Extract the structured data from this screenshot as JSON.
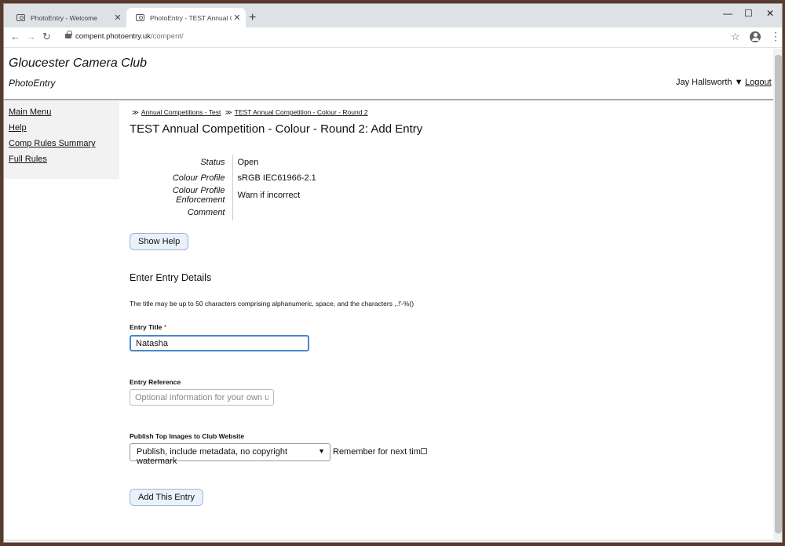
{
  "browser": {
    "tabs": [
      {
        "title": "PhotoEntry - Welcome",
        "close": "✕"
      },
      {
        "title": "PhotoEntry - TEST Annual Comp",
        "close": "✕"
      }
    ],
    "new_tab": "+",
    "window": {
      "minimize": "—",
      "maximize": "☐",
      "close": "✕"
    },
    "nav": {
      "back": "←",
      "forward": "→",
      "reload": "↻"
    },
    "url_host": "compent.photoentry.uk",
    "url_path": "/compent/",
    "star": "☆",
    "more": "⋮"
  },
  "site": {
    "title": "Gloucester Camera Club",
    "subtitle": "PhotoEntry",
    "user": "Jay Hallsworth ▼",
    "logout": "Logout"
  },
  "sidebar": {
    "items": [
      {
        "label": "Main Menu"
      },
      {
        "label": "Help"
      },
      {
        "label": "Comp Rules Summary"
      },
      {
        "label": "Full Rules"
      }
    ]
  },
  "breadcrumb": {
    "sep": "≫",
    "items": [
      "Annual Competitions - Test",
      "TEST Annual Competition - Colour - Round 2"
    ]
  },
  "page_title": "TEST Annual Competition - Colour - Round 2: Add Entry",
  "properties": [
    {
      "key": "Status",
      "value": "Open"
    },
    {
      "key": "Colour Profile",
      "value": "sRGB IEC61966-2.1"
    },
    {
      "key": "Colour Profile Enforcement",
      "value": "Warn if incorrect"
    },
    {
      "key": "Comment",
      "value": ""
    }
  ],
  "show_help": "Show Help",
  "form": {
    "heading": "Enter Entry Details",
    "note": "The title may be up to 50 characters comprising alphanumeric, space, and the characters ,.!'-%()",
    "title_label": "Entry Title",
    "required_mark": "*",
    "title_value": "Natasha",
    "reference_label": "Entry Reference",
    "reference_placeholder": "Optional information for your own use",
    "publish_label": "Publish Top Images to Club Website",
    "publish_selected": "Publish, include metadata, no copyright watermark",
    "remember_label": "Remember for next time",
    "remember_checked": false,
    "submit": "Add This Entry"
  }
}
